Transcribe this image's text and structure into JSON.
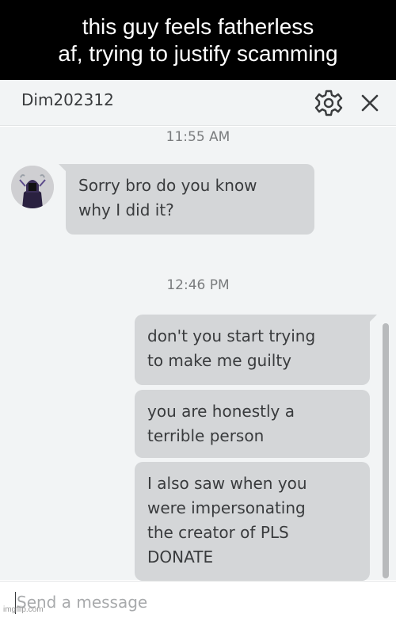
{
  "caption": {
    "line1": "this guy feels fatherless",
    "line2": "af, trying to justify scamming"
  },
  "chat": {
    "title": "Dim202312",
    "settings_icon": "gear-icon",
    "close_icon": "close-icon",
    "messages": [
      {
        "timestamp": "11:55 AM"
      },
      {
        "direction": "incoming",
        "lines": [
          "Sorry bro do you know",
          "why I did it?"
        ]
      },
      {
        "timestamp": "12:46 PM"
      },
      {
        "direction": "outgoing",
        "lines": [
          "don't you start trying",
          "to make me guilty"
        ]
      },
      {
        "direction": "outgoing",
        "lines": [
          "you are honestly a",
          "terrible person"
        ]
      },
      {
        "direction": "outgoing",
        "lines": [
          "I also saw when you",
          "were impersonating",
          "the creator of PLS",
          "DONATE"
        ]
      }
    ],
    "composer": {
      "placeholder": "Send a message"
    }
  },
  "watermark": "imgflip.com",
  "colors": {
    "caption_bg": "#000000",
    "chat_bg": "#f2f4f5",
    "bubble_bg": "#d4d6d8",
    "text": "#393b3d",
    "timestamp": "#7a7c7e"
  }
}
